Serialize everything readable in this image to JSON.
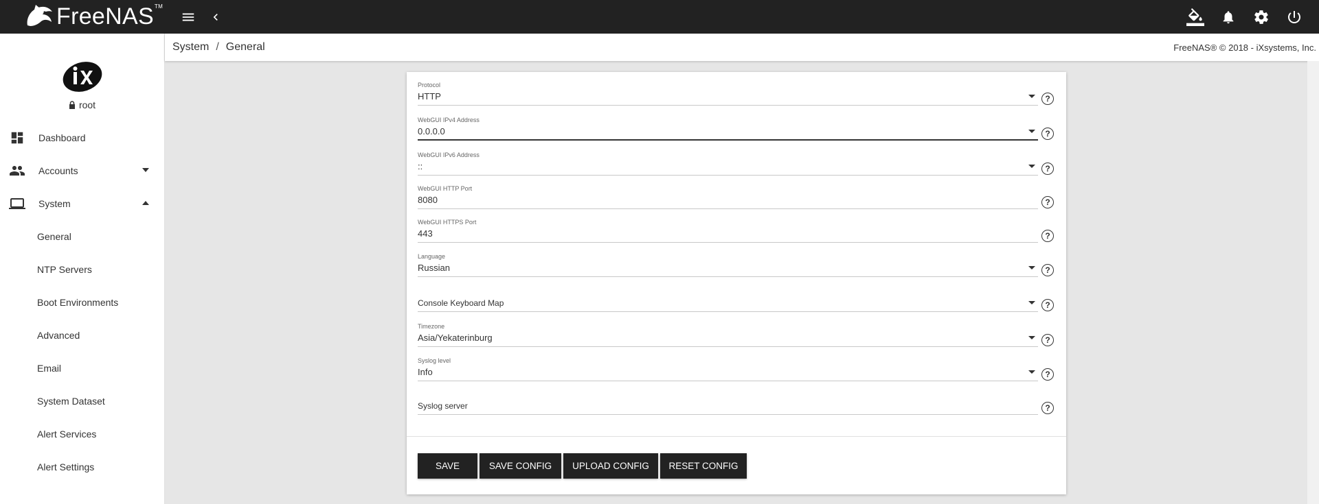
{
  "app": {
    "brand": "FreeNAS",
    "brand_tm": "TM",
    "copyright": "FreeNAS® © 2018 - iXsystems, Inc."
  },
  "topbar": {
    "icons": [
      "menu-icon",
      "chevron-left-icon",
      "theme-paint-icon",
      "bell-icon",
      "gear-icon",
      "power-icon"
    ]
  },
  "user": {
    "name": "root"
  },
  "sidebar": {
    "items": [
      {
        "label": "Dashboard",
        "icon": "dashboard-icon"
      },
      {
        "label": "Accounts",
        "icon": "people-icon",
        "expanded": false
      },
      {
        "label": "System",
        "icon": "laptop-icon",
        "expanded": true
      }
    ],
    "system_subitems": [
      "General",
      "NTP Servers",
      "Boot Environments",
      "Advanced",
      "Email",
      "System Dataset",
      "Alert Services",
      "Alert Settings"
    ]
  },
  "breadcrumb": {
    "parent": "System",
    "separator": "/",
    "current": "General"
  },
  "form": {
    "fields": [
      {
        "label": "Protocol",
        "value": "HTTP",
        "type": "select"
      },
      {
        "label": "WebGUI IPv4 Address",
        "value": "0.0.0.0",
        "type": "select",
        "focused": true
      },
      {
        "label": "WebGUI IPv6 Address",
        "value": "::",
        "type": "select"
      },
      {
        "label": "WebGUI HTTP Port",
        "value": "8080",
        "type": "input"
      },
      {
        "label": "WebGUI HTTPS Port",
        "value": "443",
        "type": "input"
      },
      {
        "label": "Language",
        "value": "Russian",
        "type": "select"
      },
      {
        "label": "",
        "value": "",
        "placeholder": "Console Keyboard Map",
        "type": "select"
      },
      {
        "label": "Timezone",
        "value": "Asia/Yekaterinburg",
        "type": "select"
      },
      {
        "label": "Syslog level",
        "value": "Info",
        "type": "select"
      },
      {
        "label": "",
        "value": "",
        "placeholder": "Syslog server",
        "type": "input"
      }
    ],
    "help_glyph": "?",
    "buttons": {
      "save": "SAVE",
      "save_config": "SAVE CONFIG",
      "upload_config": "UPLOAD CONFIG",
      "reset_config": "RESET CONFIG"
    }
  },
  "colors": {
    "topbar_bg": "#222222",
    "content_bg": "#e6e6e6",
    "button_bg": "#222222"
  }
}
